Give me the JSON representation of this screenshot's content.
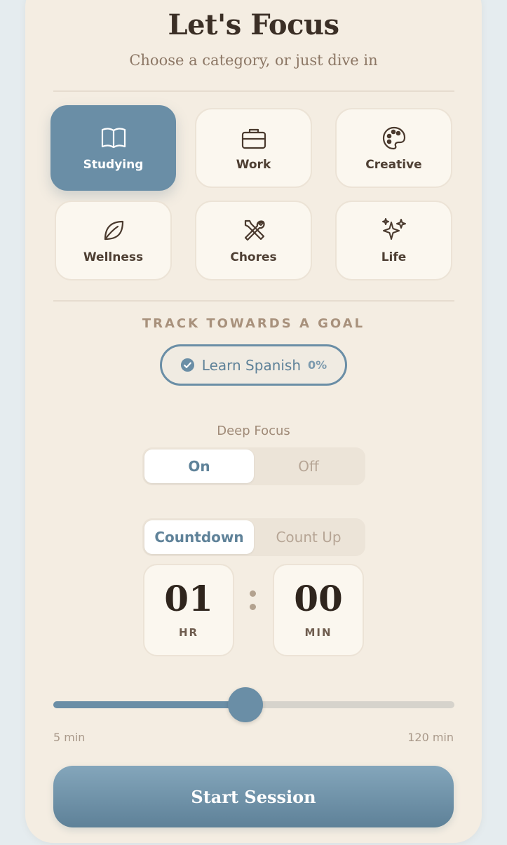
{
  "header": {
    "title": "Let's Focus",
    "subtitle": "Choose a category, or just dive in"
  },
  "categories": [
    {
      "label": "Studying",
      "icon": "book-icon",
      "selected": true
    },
    {
      "label": "Work",
      "icon": "briefcase-icon",
      "selected": false
    },
    {
      "label": "Creative",
      "icon": "palette-icon",
      "selected": false
    },
    {
      "label": "Wellness",
      "icon": "leaf-icon",
      "selected": false
    },
    {
      "label": "Chores",
      "icon": "tools-icon",
      "selected": false
    },
    {
      "label": "Life",
      "icon": "sparkles-icon",
      "selected": false
    }
  ],
  "goal": {
    "section_label": "TRACK TOWARDS A GOAL",
    "name": "Learn Spanish",
    "progress_label": "0%",
    "progress": 0
  },
  "deep_focus": {
    "label": "Deep Focus",
    "on_label": "On",
    "off_label": "Off",
    "selected": "On"
  },
  "timer_mode": {
    "countdown_label": "Countdown",
    "countup_label": "Count Up",
    "selected": "Countdown"
  },
  "timer": {
    "hours": "01",
    "hours_unit": "HR",
    "minutes": "00",
    "minutes_unit": "MIN"
  },
  "duration_slider": {
    "min_label": "5 min",
    "max_label": "120 min",
    "min": 5,
    "max": 120,
    "value": 60
  },
  "start_button": {
    "label": "Start Session"
  },
  "colors": {
    "accent": "#6a8ea6",
    "background": "#f4ede2",
    "text_dark": "#3b2f26"
  }
}
